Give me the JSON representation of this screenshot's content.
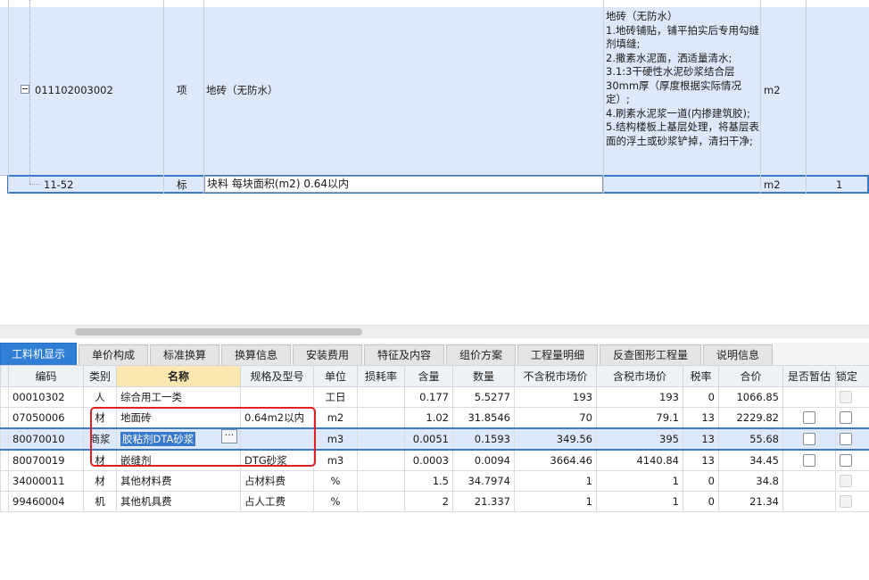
{
  "upper": {
    "item_row": {
      "code": "011102003002",
      "type": "项",
      "name": "地砖（无防水）",
      "description": "地砖（无防水）\n1.地砖铺贴，铺平拍实后专用勾缝剂填缝;\n2.撒素水泥面，洒适量清水;\n3.1:3干硬性水泥砂浆结合层30mm厚（厚度根据实际情况定）;\n4.刷素水泥浆一道(内掺建筑胶);\n5.结构楼板上基层处理，将基层表面的浮土或砂浆铲掉，清扫干净;",
      "unit": "m2"
    },
    "sub_row": {
      "code": "11-52",
      "type": "标",
      "name": "块料 每块面积(m2) 0.64以内",
      "unit": "m2",
      "qty": "1"
    }
  },
  "tabs": [
    {
      "label": "工料机显示",
      "active": true
    },
    {
      "label": "单价构成"
    },
    {
      "label": "标准换算"
    },
    {
      "label": "换算信息"
    },
    {
      "label": "安装费用"
    },
    {
      "label": "特征及内容"
    },
    {
      "label": "组价方案"
    },
    {
      "label": "工程量明细"
    },
    {
      "label": "反查图形工程量"
    },
    {
      "label": "说明信息"
    }
  ],
  "grid": {
    "headers": [
      "编码",
      "类别",
      "名称",
      "规格及型号",
      "单位",
      "损耗率",
      "含量",
      "数量",
      "不含税市场价",
      "含税市场价",
      "税率",
      "合价",
      "是否暂估",
      "锁定"
    ],
    "rows": [
      {
        "code": "00010302",
        "cat": "人",
        "name": "综合用工一类",
        "spec": "",
        "unit": "工日",
        "loss": "",
        "content": "0.177",
        "qty": "5.5277",
        "price_ex": "193",
        "price_in": "193",
        "tax": "0",
        "total": "1066.85",
        "est": false
      },
      {
        "code": "07050006",
        "cat": "材",
        "name": "地面砖",
        "spec": "0.64m2以内",
        "unit": "m2",
        "loss": "",
        "content": "1.02",
        "qty": "31.8546",
        "price_ex": "70",
        "price_in": "79.1",
        "tax": "13",
        "total": "2229.82",
        "est": true
      },
      {
        "code": "80070010",
        "cat": "商浆",
        "name": "胶粘剂DTA砂浆",
        "spec": "",
        "unit": "m3",
        "loss": "",
        "content": "0.0051",
        "qty": "0.1593",
        "price_ex": "349.56",
        "price_in": "395",
        "tax": "13",
        "total": "55.68",
        "est": true
      },
      {
        "code": "80070019",
        "cat": "材",
        "name": "嵌缝剂",
        "spec": "DTG砂浆",
        "unit": "m3",
        "loss": "",
        "content": "0.0003",
        "qty": "0.0094",
        "price_ex": "3664.46",
        "price_in": "4140.84",
        "tax": "13",
        "total": "34.45",
        "est": true
      },
      {
        "code": "34000011",
        "cat": "材",
        "name": "其他材料费",
        "spec": "占材料费",
        "unit": "%",
        "loss": "",
        "content": "1.5",
        "qty": "34.7974",
        "price_ex": "1",
        "price_in": "1",
        "tax": "0",
        "total": "34.8",
        "est": false
      },
      {
        "code": "99460004",
        "cat": "机",
        "name": "其他机具费",
        "spec": "占人工费",
        "unit": "%",
        "loss": "",
        "content": "2",
        "qty": "21.337",
        "price_ex": "1",
        "price_in": "1",
        "tax": "0",
        "total": "21.34",
        "est": false
      }
    ]
  }
}
